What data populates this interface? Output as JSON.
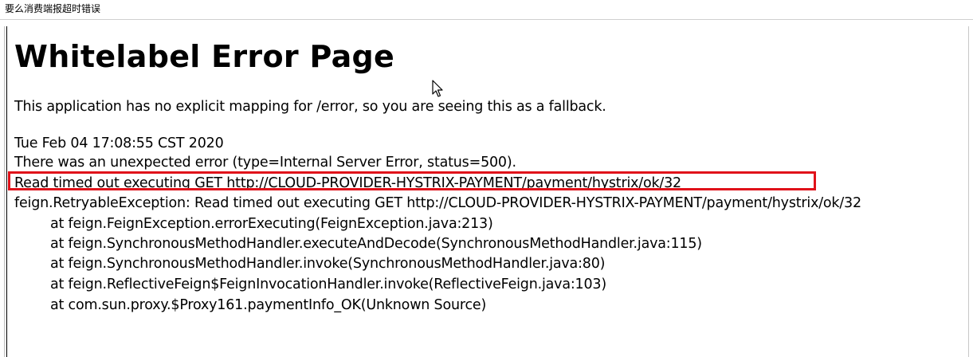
{
  "caption": "要么消费端报超时错误",
  "page": {
    "title": "Whitelabel Error Page",
    "fallback_msg": "This application has no explicit mapping for /error, so you are seeing this as a fallback.",
    "timestamp": "Tue Feb 04 17:08:55 CST 2020",
    "error_summary": "There was an unexpected error (type=Internal Server Error, status=500).",
    "highlighted_msg": "Read timed out executing GET http://CLOUD-PROVIDER-HYSTRIX-PAYMENT/payment/hystrix/ok/32",
    "exception": "feign.RetryableException: Read timed out executing GET http://CLOUD-PROVIDER-HYSTRIX-PAYMENT/payment/hystrix/ok/32",
    "stack": [
      "at feign.FeignException.errorExecuting(FeignException.java:213)",
      "at feign.SynchronousMethodHandler.executeAndDecode(SynchronousMethodHandler.java:115)",
      "at feign.SynchronousMethodHandler.invoke(SynchronousMethodHandler.java:80)",
      "at feign.ReflectiveFeign$FeignInvocationHandler.invoke(ReflectiveFeign.java:103)",
      "at com.sun.proxy.$Proxy161.paymentInfo_OK(Unknown Source)"
    ]
  },
  "colors": {
    "highlight_border": "#e0121a"
  },
  "icons": {
    "cursor": "mouse-pointer-icon"
  }
}
